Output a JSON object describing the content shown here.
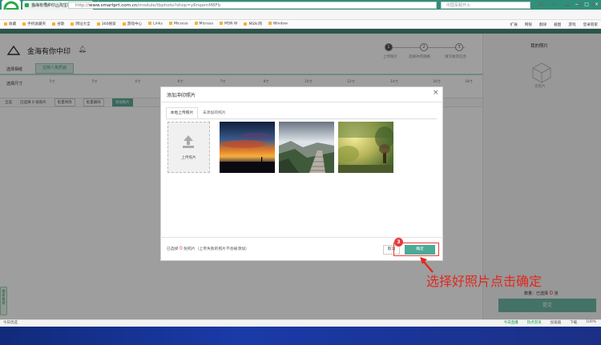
{
  "browser": {
    "tab_title": "金海有你中印 · 淘宝冲印",
    "tab_close": "×",
    "new_tab": "+",
    "address_domain": "www.smartprt.com.cn",
    "address_path": "/module/tbphoto?shop=y6nqemM8Fb",
    "address_prefix": "http://",
    "search_placeholder": "中国军舰开火",
    "window_controls": [
      "−",
      "□",
      "×"
    ],
    "bookmarks": [
      "收藏",
      "手机收藏夹",
      "谷歌",
      "网址大全",
      "360搜索",
      "游戏中心",
      "Links",
      "Microso",
      "Microso",
      "MSN W",
      "MSN 网",
      "Window"
    ],
    "bookmarks_right": [
      "扩展",
      "网银",
      "翻译",
      "截图",
      "游戏",
      "登录管家"
    ]
  },
  "site": {
    "name": "金海有你中印",
    "steps": [
      "上传照片",
      "选择冲印规格",
      "填写收货信息"
    ],
    "step_numbers": [
      "1",
      "2",
      "3"
    ],
    "select_type_label": "选择相纸",
    "type_tab": "宝丽人像质面",
    "select_size_label": "选择尺寸",
    "sizes": [
      "5寸",
      "5寸",
      "6寸",
      "6寸",
      "7寸",
      "8寸",
      "10寸",
      "12寸",
      "14寸",
      "16寸",
      "18寸"
    ],
    "toolbar": [
      "全选",
      "已选择 0 张照片",
      "批量修改",
      "批量删除",
      "添加照片"
    ]
  },
  "right_panel": {
    "title": "我的照片",
    "empty": "无照片",
    "count_label": "数量：已选择",
    "count_value": "0",
    "count_unit": "张",
    "submit": "提交"
  },
  "dialog": {
    "title": "添加冲印照片",
    "close": "×",
    "tab_local": "本地上传照片",
    "tab_unadded": "未添加的照片",
    "upload_label": "上传照片",
    "selected_prefix": "已选择",
    "selected_count": "0",
    "selected_suffix": "张照片（上传失败的照片不会被添加）",
    "cancel": "取消",
    "confirm": "确定",
    "photos": [
      "sunset-photo",
      "mountain-steps-photo",
      "foggy-forest-photo"
    ]
  },
  "annotation": {
    "badge": "3",
    "text": "选择好照片点击确定"
  },
  "status_bar": {
    "left": "今日优选",
    "right": [
      "今日直播",
      "热点资讯",
      "加速器",
      "下载",
      "",
      "100%"
    ]
  },
  "sidebar_badge": "搜索推荐",
  "colors": {
    "accent": "#4aab97",
    "highlight": "#e83a3a",
    "chrome": "#2f8f7a"
  }
}
